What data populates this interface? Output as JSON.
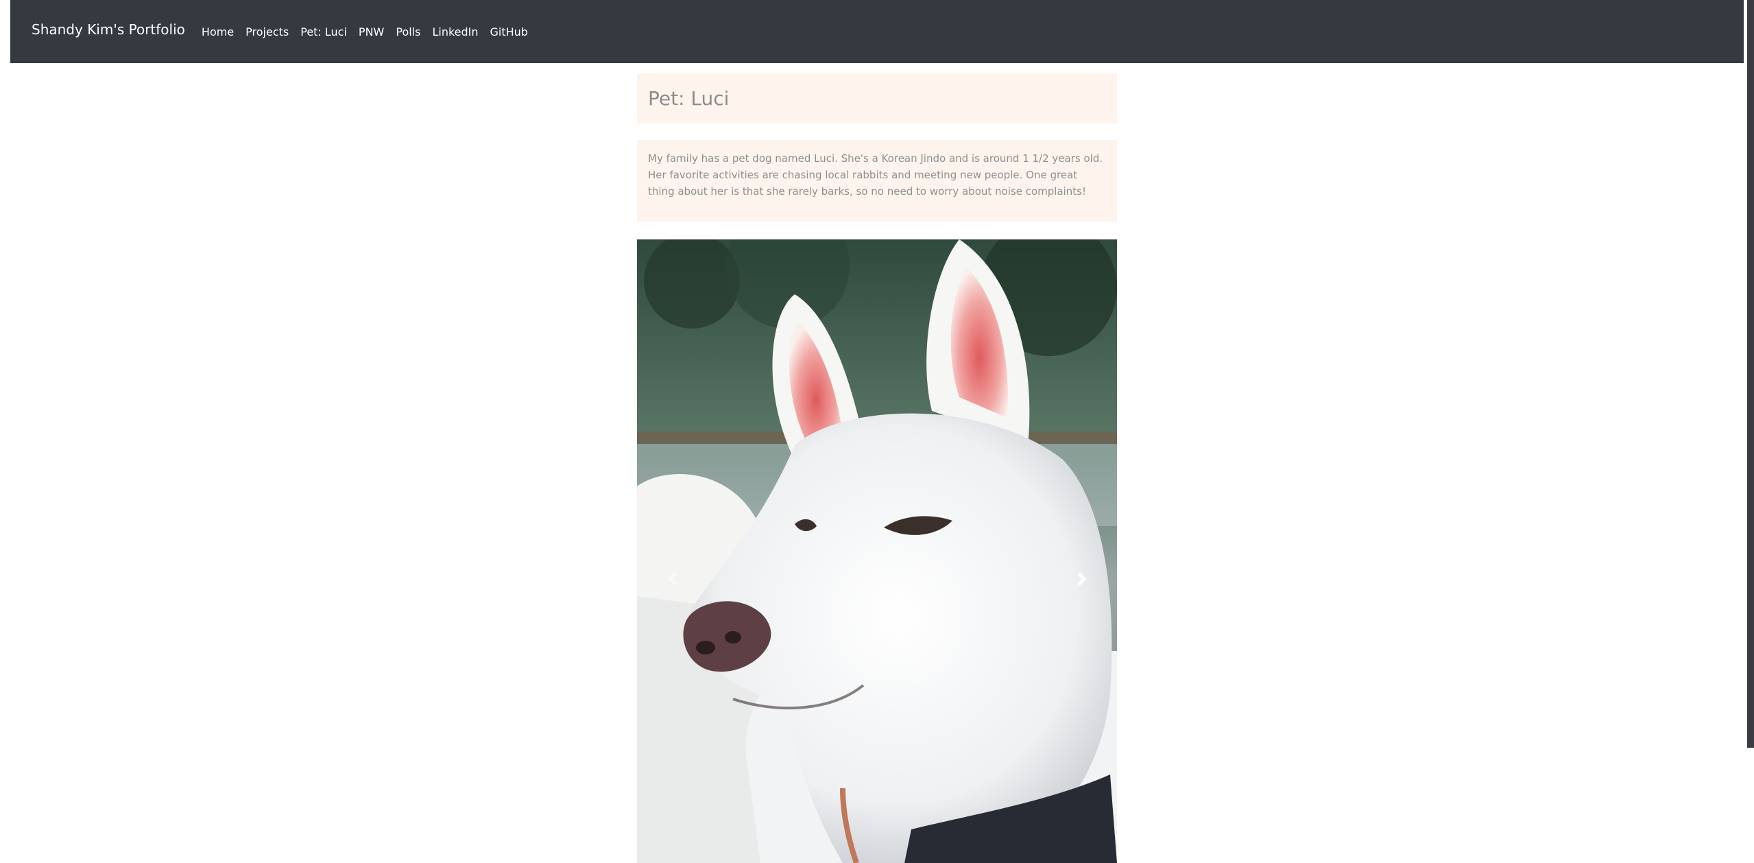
{
  "navbar": {
    "brand": "Shandy Kim's Portfolio",
    "links": [
      "Home",
      "Projects",
      "Pet: Luci",
      "PNW",
      "Polls",
      "LinkedIn",
      "GitHub"
    ]
  },
  "page": {
    "title": "Pet: Luci",
    "description": "My family has a pet dog named Luci. She's a Korean Jindo and is around 1 1/2 years old. Her favorite activities are chasing local rabbits and meeting new people. One great thing about her is that she rarely barks, so no need to worry about noise complaints!"
  },
  "carousel": {
    "prev_icon": "chevron-left-icon",
    "next_icon": "chevron-right-icon"
  },
  "colors": {
    "navbar_bg": "#343a40",
    "card_bg": "#fff3ee",
    "muted_text": "#8c8c8c"
  }
}
